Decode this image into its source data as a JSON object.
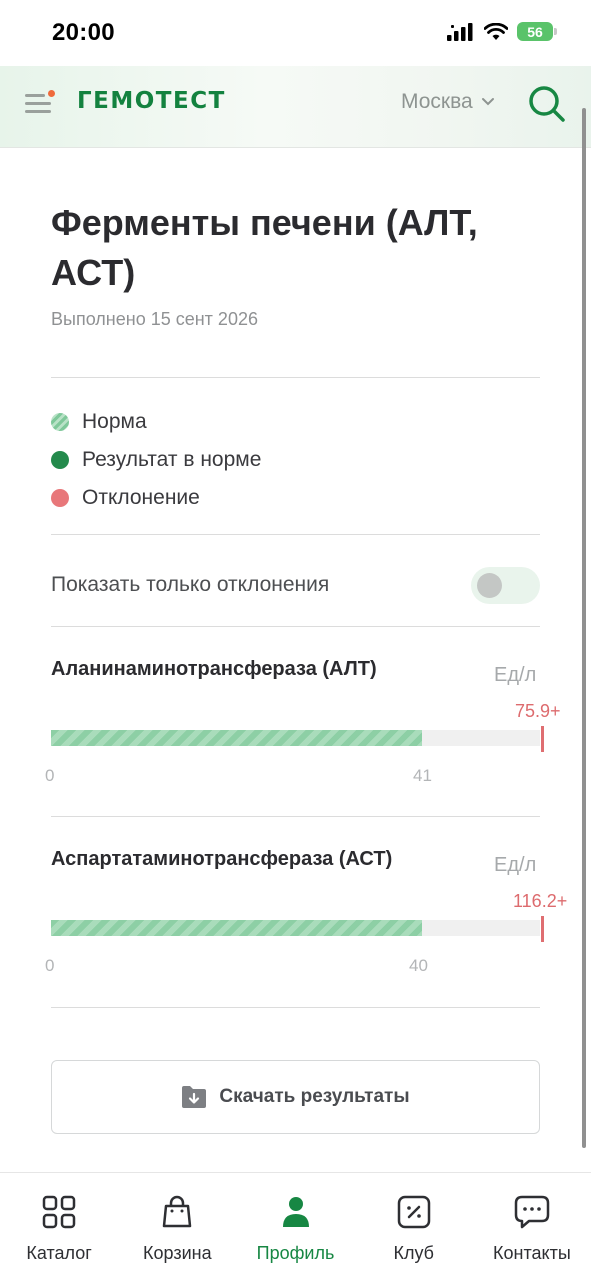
{
  "status_bar": {
    "time": "20:00",
    "battery": "56"
  },
  "header": {
    "brand": "ГЕМОТЕСТ",
    "city": "Москва",
    "colors": {
      "brand": "#13823f",
      "accent_dot": "#ef6a3b"
    }
  },
  "page": {
    "title": "Ферменты печени (АЛТ, АСТ)",
    "completed": "Выполнено 15 сент 2026"
  },
  "legend": [
    {
      "label": "Норма",
      "color": "#8dcfa5"
    },
    {
      "label": "Результат в норме",
      "color": "#248a4c"
    },
    {
      "label": "Отклонение",
      "color": "#e8777a"
    }
  ],
  "filter": {
    "label": "Показать только отклонения",
    "enabled": false
  },
  "tests": [
    {
      "name": "Аланинаминотрансфераза (АЛТ)",
      "unit": "Ед/л",
      "value_label": "75.9+",
      "norm_min": "0",
      "norm_max": "41",
      "status": "deviation"
    },
    {
      "name": "Аспартатаминотрансфераза (АСТ)",
      "unit": "Ед/л",
      "value_label": "116.2+",
      "norm_min": "0",
      "norm_max": "40",
      "status": "deviation"
    }
  ],
  "download": {
    "label": "Скачать результаты",
    "icon": "download-folder-icon"
  },
  "bottom_nav": [
    {
      "label": "Каталог",
      "icon": "catalog-grid-icon",
      "active": false
    },
    {
      "label": "Корзина",
      "icon": "shopping-bag-icon",
      "active": false
    },
    {
      "label": "Профиль",
      "icon": "profile-icon",
      "active": true
    },
    {
      "label": "Клуб",
      "icon": "discount-icon",
      "active": false
    },
    {
      "label": "Контакты",
      "icon": "chat-icon",
      "active": false
    }
  ]
}
